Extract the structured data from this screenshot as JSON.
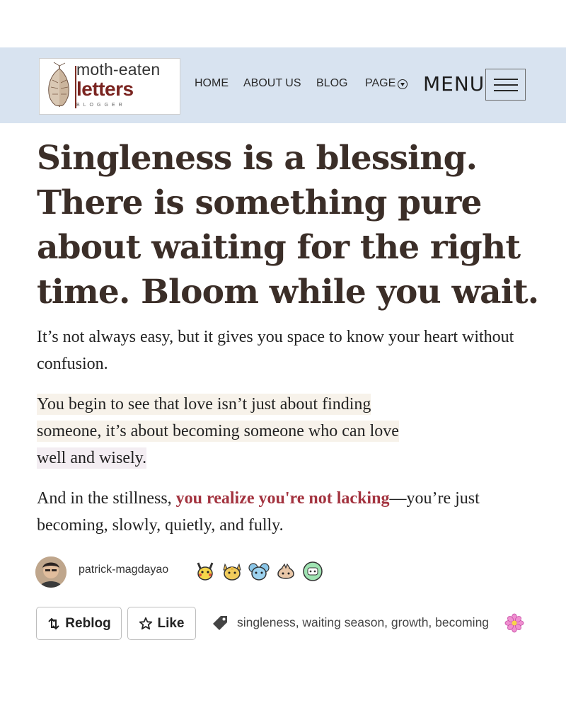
{
  "logo": {
    "line1": "moth-eaten",
    "line2": "letters",
    "line3": "BLOGGER"
  },
  "nav": {
    "home": "HOME",
    "about": "ABOUT US",
    "blog": "BLOG",
    "page": "PAGE",
    "menu": "MENU"
  },
  "post": {
    "title": "Singleness is a blessing. There is something pure about waiting for the right time. Bloom while you wait.",
    "p1": "It’s not always easy, but it gives you space to know your heart without confusion.",
    "p2_line1": "You begin to see that love isn’t just about finding",
    "p2_line2": "someone, it’s about becoming someone who can love",
    "p2_line3": "well and wisely.",
    "p3_before": "And in the stillness, ",
    "p3_emph": "you realize you're not lacking",
    "p3_after": "—you’re just becoming, slowly, quietly, and fully."
  },
  "author": {
    "name": "patrick-magdayao",
    "badges": [
      "pikachu-badge",
      "meowth-badge",
      "blue-creature-badge",
      "clefable-badge",
      "discord-badge"
    ]
  },
  "actions": {
    "reblog": "Reblog",
    "like": "Like"
  },
  "tags": "singleness, waiting season, growth, becoming",
  "colors": {
    "header_bg": "#d8e3f0",
    "title": "#3b2e28",
    "emphasis": "#a3333f",
    "logo_accent": "#7a2420"
  }
}
